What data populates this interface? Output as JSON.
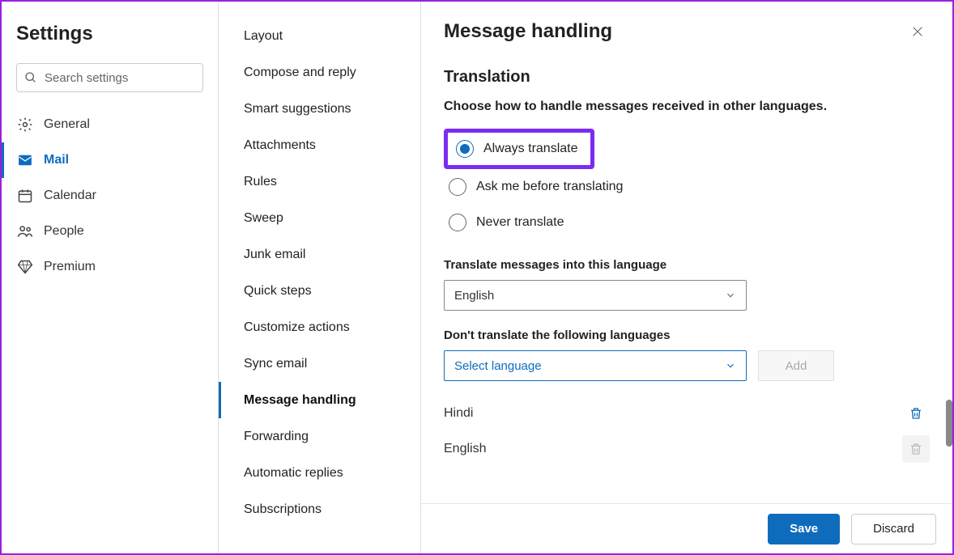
{
  "header": {
    "title": "Settings"
  },
  "search": {
    "placeholder": "Search settings"
  },
  "nav": {
    "items": [
      {
        "key": "general",
        "label": "General",
        "icon": "gear",
        "active": false
      },
      {
        "key": "mail",
        "label": "Mail",
        "icon": "mail",
        "active": true
      },
      {
        "key": "calendar",
        "label": "Calendar",
        "icon": "calendar",
        "active": false
      },
      {
        "key": "people",
        "label": "People",
        "icon": "people",
        "active": false
      },
      {
        "key": "premium",
        "label": "Premium",
        "icon": "diamond",
        "active": false
      }
    ]
  },
  "subnav": {
    "items": [
      {
        "label": "Layout"
      },
      {
        "label": "Compose and reply"
      },
      {
        "label": "Smart suggestions"
      },
      {
        "label": "Attachments"
      },
      {
        "label": "Rules"
      },
      {
        "label": "Sweep"
      },
      {
        "label": "Junk email"
      },
      {
        "label": "Quick steps"
      },
      {
        "label": "Customize actions"
      },
      {
        "label": "Sync email"
      },
      {
        "label": "Message handling",
        "active": true
      },
      {
        "label": "Forwarding"
      },
      {
        "label": "Automatic replies"
      },
      {
        "label": "Subscriptions"
      }
    ]
  },
  "panel": {
    "title": "Message handling",
    "section": "Translation",
    "description": "Choose how to handle messages received in other languages.",
    "radios": [
      {
        "label": "Always translate",
        "selected": true,
        "highlighted": true
      },
      {
        "label": "Ask me before translating",
        "selected": false
      },
      {
        "label": "Never translate",
        "selected": false
      }
    ],
    "translate_into_label": "Translate messages into this language",
    "translate_into_value": "English",
    "dont_translate_label": "Don't translate the following languages",
    "select_lang_placeholder": "Select language",
    "add_label": "Add",
    "excluded_languages": [
      {
        "name": "Hindi",
        "deletable": true
      },
      {
        "name": "English",
        "deletable": false
      }
    ],
    "save_label": "Save",
    "discard_label": "Discard"
  }
}
